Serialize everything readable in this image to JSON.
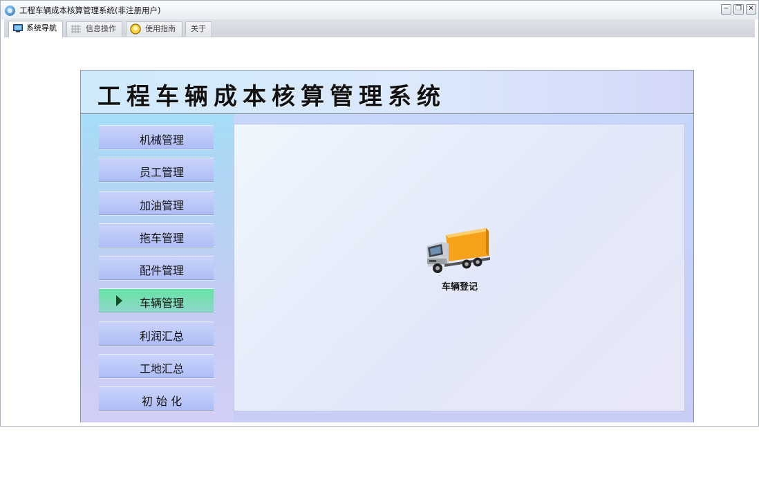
{
  "window": {
    "title": "工程车辆成本核算管理系统(非注册用户)",
    "controls": [
      "minimize",
      "restore",
      "close"
    ]
  },
  "tabs": [
    {
      "label": "系统导航",
      "icon": "monitor-icon",
      "active": true
    },
    {
      "label": "信息操作",
      "icon": "grid-icon",
      "active": false
    },
    {
      "label": "使用指南",
      "icon": "lightbulb-icon",
      "active": false
    },
    {
      "label": "关于",
      "icon": "",
      "active": false
    }
  ],
  "app": {
    "banner_title": "工程车辆成本核算管理系统",
    "nav": [
      {
        "label": "机械管理",
        "active": false
      },
      {
        "label": "员工管理",
        "active": false
      },
      {
        "label": "加油管理",
        "active": false
      },
      {
        "label": "拖车管理",
        "active": false
      },
      {
        "label": "配件管理",
        "active": false
      },
      {
        "label": "车辆管理",
        "active": true
      },
      {
        "label": "利润汇总",
        "active": false
      },
      {
        "label": "工地汇总",
        "active": false
      },
      {
        "label": "初 始 化",
        "active": false
      }
    ],
    "main": {
      "tile_label": "车辆登记",
      "tile_icon": "truck-icon"
    }
  },
  "colors": {
    "accent_active_nav": "#66e3a4",
    "nav_arrow": "#0e4f24",
    "nav_button": "#b8c6f7"
  }
}
